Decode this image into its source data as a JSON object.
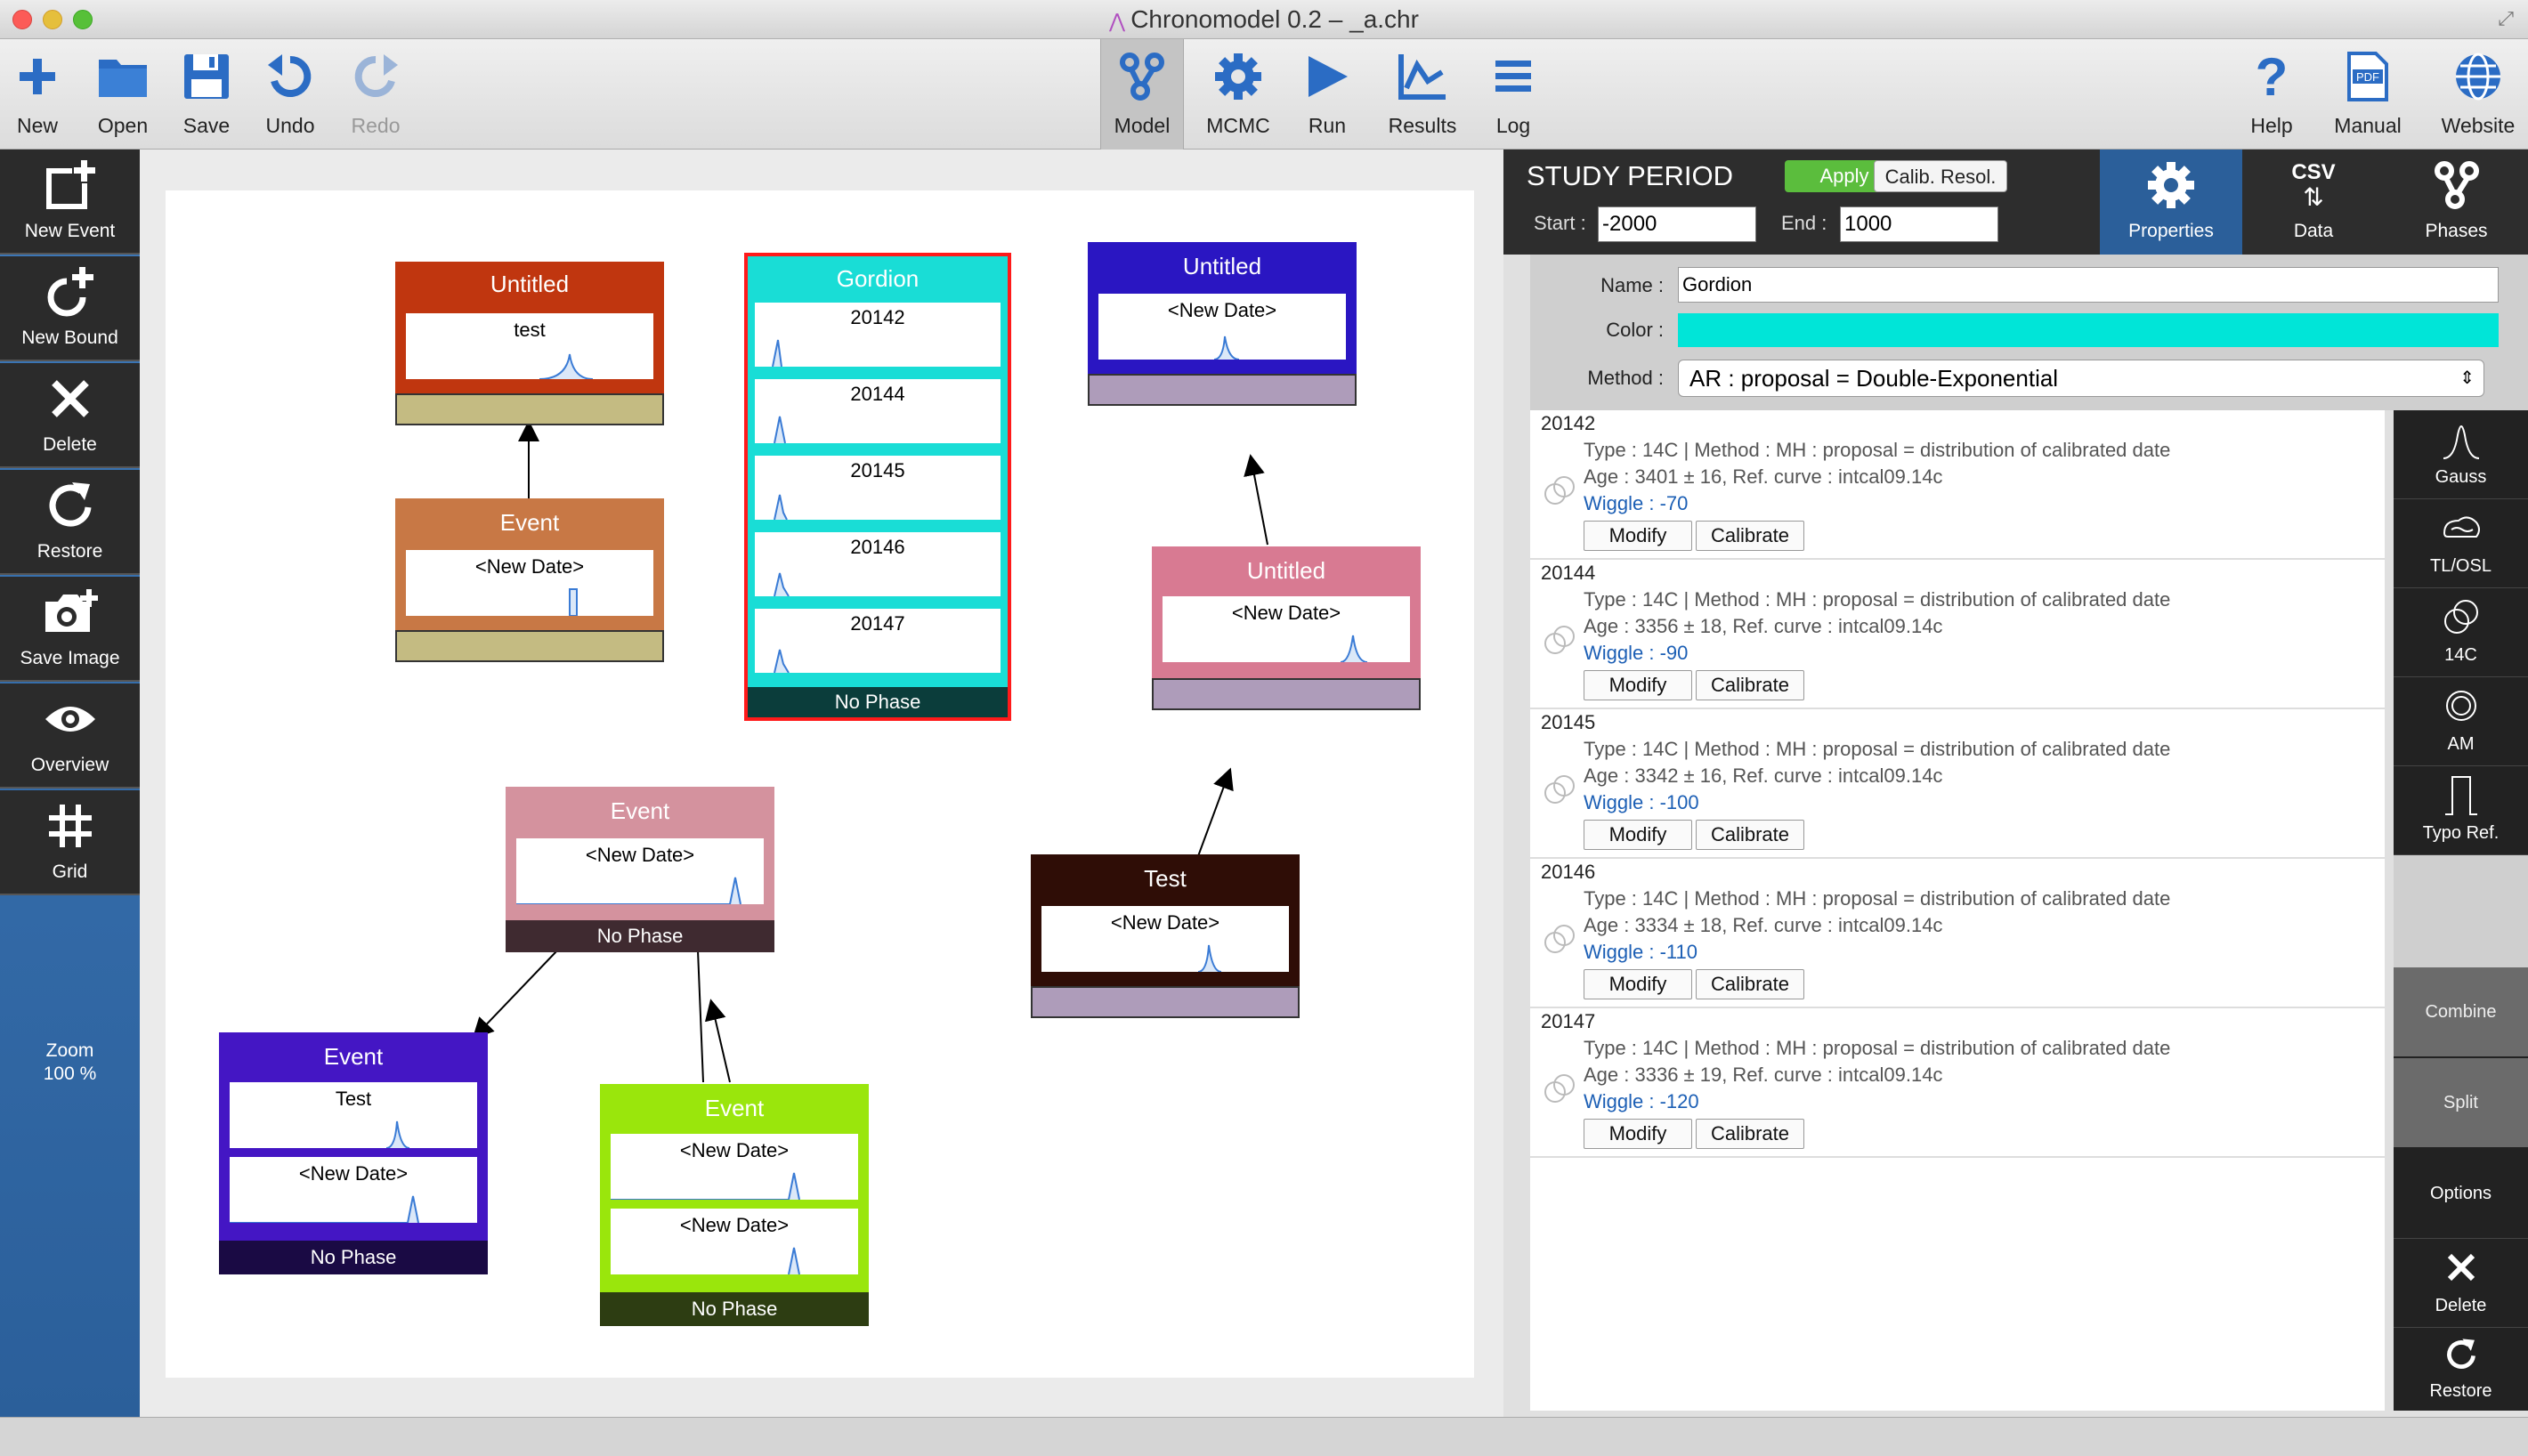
{
  "window": {
    "title": "Chronomodel 0.2 – _a.chr"
  },
  "toolbar": {
    "new": "New",
    "open": "Open",
    "save": "Save",
    "undo": "Undo",
    "redo": "Redo",
    "model": "Model",
    "mcmc": "MCMC",
    "run": "Run",
    "results": "Results",
    "log": "Log",
    "help": "Help",
    "manual": "Manual",
    "website": "Website"
  },
  "left_tools": {
    "new_event": "New Event",
    "new_bound": "New Bound",
    "delete": "Delete",
    "restore": "Restore",
    "save_image": "Save Image",
    "overview": "Overview",
    "grid": "Grid",
    "zoom_label": "Zoom",
    "zoom_value": "100 %"
  },
  "scene": {
    "untitled1": {
      "title": "Untitled",
      "date": "test",
      "color": "#c0360f",
      "phase_color": "#c4bb82"
    },
    "event1": {
      "title": "Event",
      "date": "<New Date>",
      "color": "#c87845",
      "phase_color": "#c4bb82"
    },
    "gordion": {
      "title": "Gordion",
      "dates": [
        "20142",
        "20144",
        "20145",
        "20146",
        "20147"
      ],
      "phase": "No Phase",
      "color": "#19ddd6"
    },
    "untitled2": {
      "title": "Untitled",
      "date": "<New Date>",
      "color": "#2a16c2",
      "phase_color": "#ae9cba"
    },
    "untitled3": {
      "title": "Untitled",
      "date": "<New Date>",
      "color": "#d87a92",
      "phase_color": "#ae9cba"
    },
    "event_pink": {
      "title": "Event",
      "date": "<New Date>",
      "phase": "No Phase",
      "color": "#d4929e"
    },
    "test": {
      "title": "Test",
      "date": "<New Date>",
      "color": "#2f0d06",
      "phase_color": "#ae9cba"
    },
    "event_purple": {
      "title": "Event",
      "dates": [
        "Test",
        "<New Date>"
      ],
      "phase": "No Phase",
      "color": "#4416c4"
    },
    "event_green": {
      "title": "Event",
      "dates": [
        "<New Date>",
        "<New Date>"
      ],
      "phase": "No Phase",
      "color": "#9ae60c"
    }
  },
  "study": {
    "title": "STUDY PERIOD",
    "apply": "Apply",
    "calib": "Calib. Resol.",
    "start_label": "Start :",
    "start": "-2000",
    "end_label": "End :",
    "end": "1000"
  },
  "tabs": {
    "properties": "Properties",
    "data": "Data",
    "phases": "Phases",
    "csv": "CSV"
  },
  "properties": {
    "name_label": "Name :",
    "name": "Gordion",
    "color_label": "Color :",
    "color": "#00e5d8",
    "method_label": "Method :",
    "method": "AR : proposal = Double-Exponential"
  },
  "dates": [
    {
      "name": "20142",
      "type": "Type : 14C | Method : MH : proposal = distribution of calibrated date",
      "age": "Age : 3401 ± 16, Ref. curve : intcal09.14c",
      "wiggle": "Wiggle : -70"
    },
    {
      "name": "20144",
      "type": "Type : 14C | Method : MH : proposal = distribution of calibrated date",
      "age": "Age : 3356 ± 18, Ref. curve : intcal09.14c",
      "wiggle": "Wiggle : -90"
    },
    {
      "name": "20145",
      "type": "Type : 14C | Method : MH : proposal = distribution of calibrated date",
      "age": "Age : 3342 ± 16, Ref. curve : intcal09.14c",
      "wiggle": "Wiggle : -100"
    },
    {
      "name": "20146",
      "type": "Type : 14C | Method : MH : proposal = distribution of calibrated date",
      "age": "Age : 3334 ± 18, Ref. curve : intcal09.14c",
      "wiggle": "Wiggle : -110"
    },
    {
      "name": "20147",
      "type": "Type : 14C | Method : MH : proposal = distribution of calibrated date",
      "age": "Age : 3336 ± 19, Ref. curve : intcal09.14c",
      "wiggle": "Wiggle : -120"
    }
  ],
  "date_buttons": {
    "modify": "Modify",
    "calibrate": "Calibrate"
  },
  "right_side": {
    "gauss": "Gauss",
    "tlosl": "TL/OSL",
    "c14": "14C",
    "am": "AM",
    "typo": "Typo Ref.",
    "combine": "Combine",
    "split": "Split",
    "options": "Options",
    "delete": "Delete",
    "restore": "Restore"
  }
}
